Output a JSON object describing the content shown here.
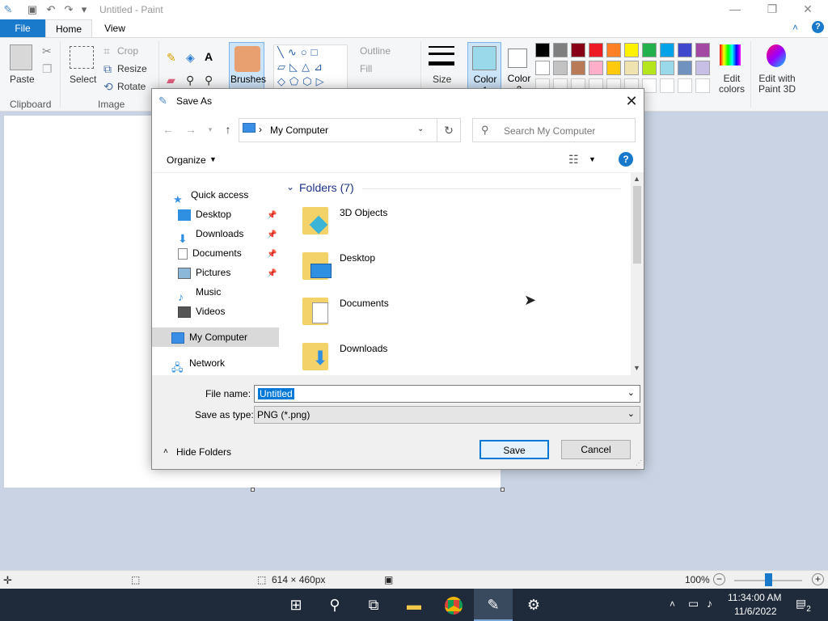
{
  "titlebar": {
    "title": "Untitled - Paint",
    "qat_dropdown": "▾"
  },
  "tabs": {
    "file": "File",
    "home": "Home",
    "view": "View"
  },
  "ribbon": {
    "clipboard": {
      "paste": "Paste",
      "group": "Clipboard"
    },
    "image": {
      "select": "Select",
      "crop": "Crop",
      "resize": "Resize",
      "rotate": "Rotate",
      "group": "Image"
    },
    "brushes": "Brushes",
    "shapes": {
      "outline": "Outline",
      "fill": "Fill"
    },
    "size": "Size",
    "color1": "Color 1",
    "color2": "Color 2",
    "edit_colors": "Edit colors",
    "edit_3d": "Edit with Paint 3D",
    "palette_top": [
      "#000000",
      "#7f7f7f",
      "#880015",
      "#ed1c24",
      "#ff7f27",
      "#fff200",
      "#22b14c",
      "#00a2e8",
      "#3f48cc",
      "#a349a4"
    ],
    "palette_mid": [
      "#ffffff",
      "#c3c3c3",
      "#b97a57",
      "#ffaec9",
      "#ffc90e",
      "#efe4b0",
      "#b5e61d",
      "#99d9ea",
      "#7092be",
      "#c8bfe7"
    ],
    "color1_value": "#99d9ea"
  },
  "dialog": {
    "title": "Save As",
    "address": "My Computer",
    "search_placeholder": "Search My Computer",
    "organize": "Organize",
    "nav": {
      "quick_access": "Quick access",
      "items": [
        "Desktop",
        "Downloads",
        "Documents",
        "Pictures",
        "Music",
        "Videos"
      ],
      "my_computer": "My Computer",
      "network": "Network"
    },
    "folders_header": "Folders (7)",
    "folders": [
      "3D Objects",
      "Desktop",
      "Documents",
      "Downloads"
    ],
    "filename_label": "File name:",
    "filename_value": "Untitled",
    "savetype_label": "Save as type:",
    "savetype_value": "PNG (*.png)",
    "hide_folders": "Hide Folders",
    "save": "Save",
    "cancel": "Cancel"
  },
  "statusbar": {
    "dimensions": "614 × 460px",
    "zoom": "100%"
  },
  "taskbar": {
    "time": "11:34:00 AM",
    "date": "11/6/2022",
    "notifications": "2"
  }
}
